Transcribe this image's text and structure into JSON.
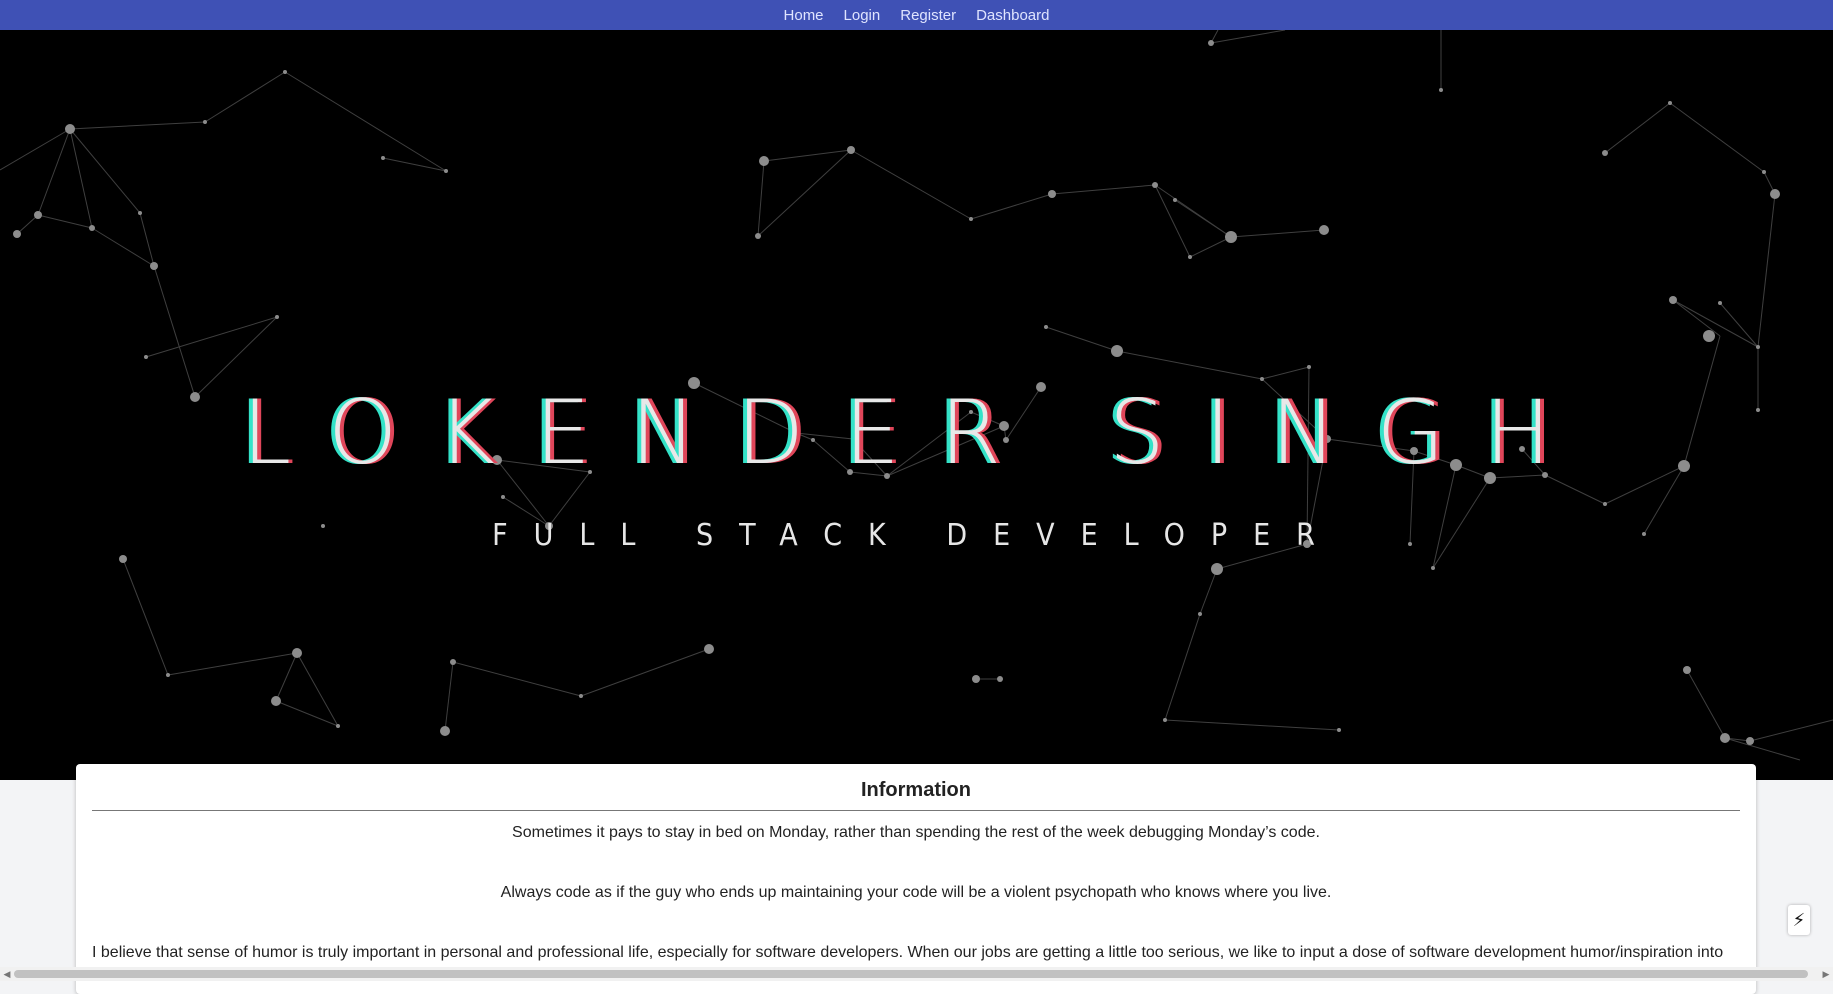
{
  "nav": {
    "items": [
      "Home",
      "Login",
      "Register",
      "Dashboard"
    ]
  },
  "hero": {
    "title": "LOKENDER SINGH",
    "subtitle": "FULL STACK DEVELOPER"
  },
  "info": {
    "title": "Information",
    "paragraphs": [
      "Sometimes it pays to stay in bed on Monday, rather than spending the rest of the week debugging Monday’s code.",
      "Always code as if the guy who ends up maintaining your code will be a violent psychopath who knows where you live.",
      "I believe that sense of humor is truly important in personal and professional life, especially for software developers. When our jobs are getting a little too serious, we like to input a dose of software development humor/inspiration into"
    ]
  },
  "icons": {
    "flash": "lightning-icon",
    "scroll_left": "arrow-left-icon",
    "scroll_right": "arrow-right-icon"
  },
  "colors": {
    "navbar": "#3f51b5",
    "hero_bg": "#000000",
    "glitch_cyan": "#34e2c8",
    "glitch_red": "#e0465a"
  }
}
